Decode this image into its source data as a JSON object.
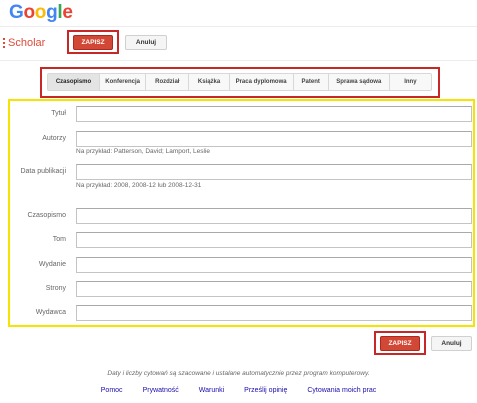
{
  "header": {
    "logo": {
      "letters": [
        "G",
        "o",
        "o",
        "g",
        "l",
        "e"
      ],
      "colors": [
        "#4285f4",
        "#ea4335",
        "#fbbc05",
        "#4285f4",
        "#34a853",
        "#ea4335"
      ]
    },
    "product_name": "Scholar",
    "save_label": "ZAPISZ",
    "cancel_label": "Anuluj"
  },
  "tabs": [
    {
      "label": "Czasopismo",
      "active": true
    },
    {
      "label": "Konferencja",
      "active": false
    },
    {
      "label": "Rozdział",
      "active": false
    },
    {
      "label": "Książka",
      "active": false
    },
    {
      "label": "Praca dyplomowa",
      "active": false
    },
    {
      "label": "Patent",
      "active": false
    },
    {
      "label": "Sprawa sądowa",
      "active": false
    },
    {
      "label": "Inny",
      "active": false
    }
  ],
  "form": {
    "title": {
      "label": "Tytuł",
      "value": ""
    },
    "authors": {
      "label": "Autorzy",
      "value": "",
      "hint": "Na przykład: Patterson, David; Lamport, Leslie"
    },
    "pub_date": {
      "label": "Data publikacji",
      "value": "",
      "hint": "Na przykład: 2008, 2008-12 lub 2008-12-31"
    },
    "journal": {
      "label": "Czasopismo",
      "value": ""
    },
    "volume": {
      "label": "Tom",
      "value": ""
    },
    "issue": {
      "label": "Wydanie",
      "value": ""
    },
    "pages": {
      "label": "Strony",
      "value": ""
    },
    "publisher": {
      "label": "Wydawca",
      "value": ""
    }
  },
  "bottom": {
    "save_label": "ZAPISZ",
    "cancel_label": "Anuluj"
  },
  "footer": {
    "note": "Daty i liczby cytowań są szacowane i ustalane automatycznie przez program komputerowy.",
    "links": [
      "Pomoc",
      "Prywatność",
      "Warunki",
      "Prześlij opinię",
      "Cytowania moich prac"
    ]
  },
  "colors": {
    "brand_red": "#dd4b39",
    "button_red": "#d14836",
    "highlight_red": "#c62828",
    "highlight_yellow": "#f5e400",
    "link_blue": "#1a0dab"
  }
}
